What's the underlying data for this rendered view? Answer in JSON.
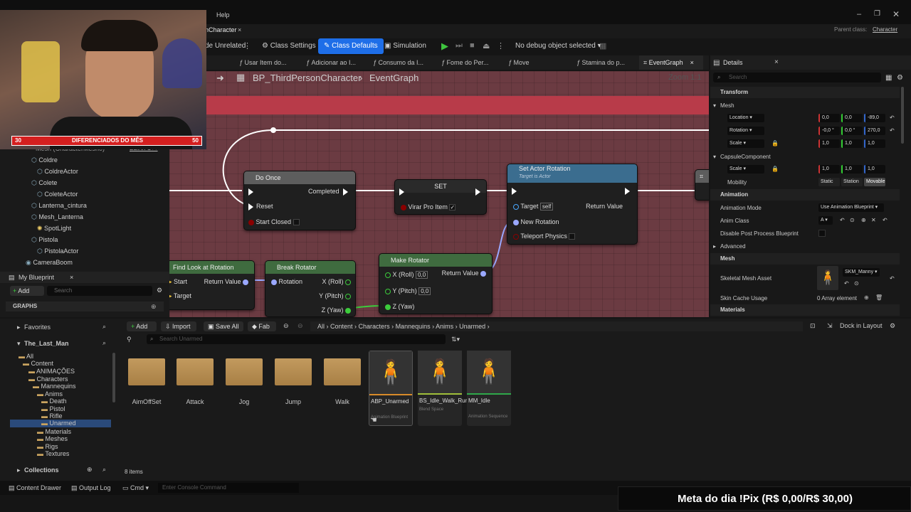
{
  "menu": {
    "help": "Help"
  },
  "tab": {
    "name": "nCharacter",
    "close": "×"
  },
  "parent": {
    "label": "Parent class:",
    "value": "Character"
  },
  "toolbar": {
    "unrelated": "de Unrelated",
    "class_settings": "Class Settings",
    "class_defaults": "Class Defaults",
    "simulation": "Simulation",
    "debug": "No debug object selected"
  },
  "graph_tabs": [
    "Usar Item do...",
    "Adicionar ao I...",
    "Consumo da I...",
    "Fome do Per...",
    "Move",
    "Stamina do p...",
    "EventGraph"
  ],
  "details_title": "Details",
  "breadcrumb": {
    "bp": "BP_ThirdPersonCharacter",
    "graph": "EventGraph",
    "zoom": "Zoom 1:1"
  },
  "nodes": {
    "do_once": {
      "title": "Do Once",
      "completed": "Completed",
      "reset": "Reset",
      "start_closed": "Start Closed"
    },
    "set": {
      "title": "SET",
      "var": "Virar Pro Item"
    },
    "set_rot": {
      "title": "Set Actor Rotation",
      "sub": "Target is Actor",
      "target": "Target",
      "self": "self",
      "ret": "Return Value",
      "new_rot": "New Rotation",
      "teleport": "Teleport Physics"
    },
    "find": {
      "title": "Find Look at Rotation",
      "start": "Start",
      "target": "Target",
      "ret": "Return Value"
    },
    "break": {
      "title": "Break Rotator",
      "rotation": "Rotation",
      "x": "X (Roll)",
      "y": "Y (Pitch)",
      "z": "Z (Yaw)"
    },
    "make": {
      "title": "Make Rotator",
      "x": "X (Roll)",
      "y": "Y (Pitch)",
      "z": "Z (Yaw)",
      "xv": "0,0",
      "yv": "0,0",
      "ret": "Return Value"
    }
  },
  "components": {
    "items": [
      "Mesh (CharacterMesh0)",
      "Coldre",
      "ColdreActor",
      "Colete",
      "ColeteActor",
      "Lanterna_cintura",
      "Mesh_Lanterna",
      "SpotLight",
      "Pistola",
      "PistolaActor",
      "CameraBoom"
    ],
    "edit": "Edit in C++"
  },
  "my_blueprint": {
    "title": "My Blueprint",
    "add": "Add",
    "search": "Search",
    "graphs": "GRAPHS"
  },
  "details": {
    "search": "Search",
    "transform": "Transform",
    "mesh": "Mesh",
    "location": "Location",
    "loc": [
      "0,0",
      "0,0",
      "-89,0"
    ],
    "rotation": "Rotation",
    "rot": [
      "-0,0 °",
      "0,0 °",
      "270,0"
    ],
    "scale": "Scale",
    "scl": [
      "1,0",
      "1,0",
      "1,0"
    ],
    "capsule": "CapsuleComponent",
    "cscl": [
      "1,0",
      "1,0",
      "1,0"
    ],
    "mobility": "Mobility",
    "mob": [
      "Static",
      "Station",
      "Movable"
    ],
    "animation": "Animation",
    "anim_mode": "Animation Mode",
    "anim_mode_v": "Use Animation Blueprint",
    "anim_class": "Anim Class",
    "anim_class_v": "A",
    "disable_pp": "Disable Post Process Blueprint",
    "advanced": "Advanced",
    "mesh2": "Mesh",
    "skel": "Skeletal Mesh Asset",
    "skel_v": "SKM_Manny",
    "skin": "Skin Cache Usage",
    "skin_v": "0 Array element",
    "materials": "Materials"
  },
  "cb": {
    "add": "Add",
    "import": "Import",
    "save_all": "Save All",
    "fab": "Fab",
    "path": [
      "All",
      "Content",
      "Characters",
      "Mannequins",
      "Anims",
      "Unarmed"
    ],
    "dock": "Dock in Layout",
    "search": "Search Unarmed",
    "favorites": "Favorites",
    "project": "The_Last_Man",
    "collections": "Collections",
    "tree": [
      "All",
      "Content",
      "ANIMAÇÕES",
      "Characters",
      "Mannequins",
      "Anims",
      "Death",
      "Pistol",
      "Rifle",
      "Unarmed",
      "Materials",
      "Meshes",
      "Rigs",
      "Textures"
    ],
    "folders": [
      "AimOffSet",
      "Attack",
      "Jog",
      "Jump",
      "Walk"
    ],
    "assets": [
      {
        "name": "ABP_Unarmed",
        "type": "Animation Blueprint",
        "color": "#d88a2a"
      },
      {
        "name": "BS_Idle_Walk_Run",
        "type": "Blend Space",
        "color": "#a0bf3a"
      },
      {
        "name": "MM_Idle",
        "type": "Animation Sequence",
        "color": "#2fa84a"
      }
    ],
    "count": "8 items"
  },
  "bottom": {
    "drawer": "Content Drawer",
    "log": "Output Log",
    "cmd": "Cmd",
    "console": "Enter Console Command"
  },
  "stream": {
    "left": "30",
    "banner": "DIFERENCIADOS DO MÊS",
    "right": "50",
    "goal": "Meta do dia !Pix (R$ 0,00/R$ 30,00)"
  }
}
